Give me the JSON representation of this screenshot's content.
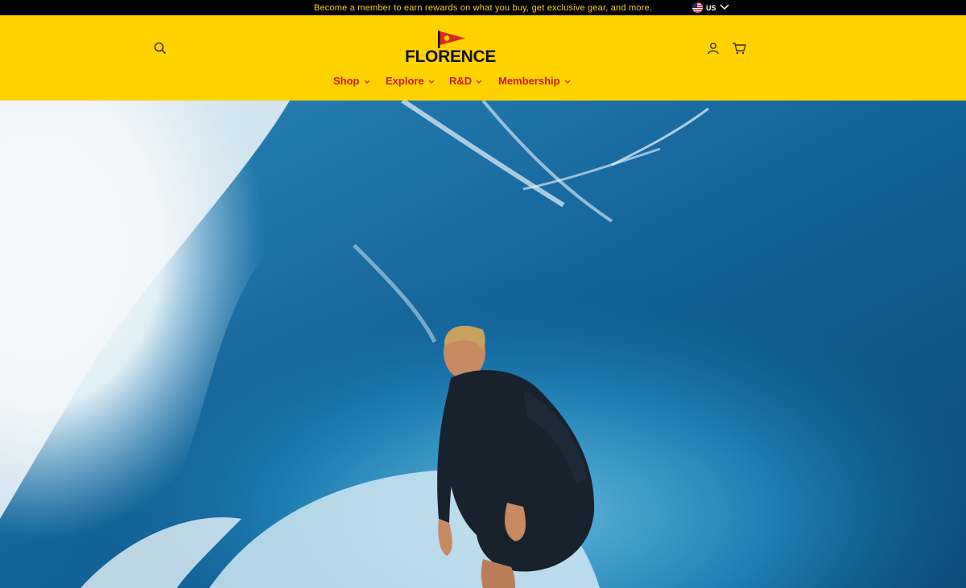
{
  "announcement": {
    "text": "Become a member to earn rewards on what you buy, get exclusive gear, and more."
  },
  "locale": {
    "country": "US",
    "flag_icon": "us-flag-icon"
  },
  "brand": {
    "name": "FLORENCE",
    "logo_icon": "pennant-flag-icon"
  },
  "header_icons": {
    "search": "search-icon",
    "account": "account-icon",
    "cart": "cart-icon"
  },
  "nav": {
    "items": [
      {
        "label": "Shop"
      },
      {
        "label": "Explore"
      },
      {
        "label": "R&D"
      },
      {
        "label": "Membership"
      }
    ]
  },
  "colors": {
    "header_bg": "#ffd200",
    "announce_bg": "#000000",
    "announce_text": "#f5cd2a",
    "nav_text": "#cc1b17",
    "flag_red": "#e0281c"
  },
  "hero": {
    "subject": "surfer-in-barrel-wave-image"
  }
}
